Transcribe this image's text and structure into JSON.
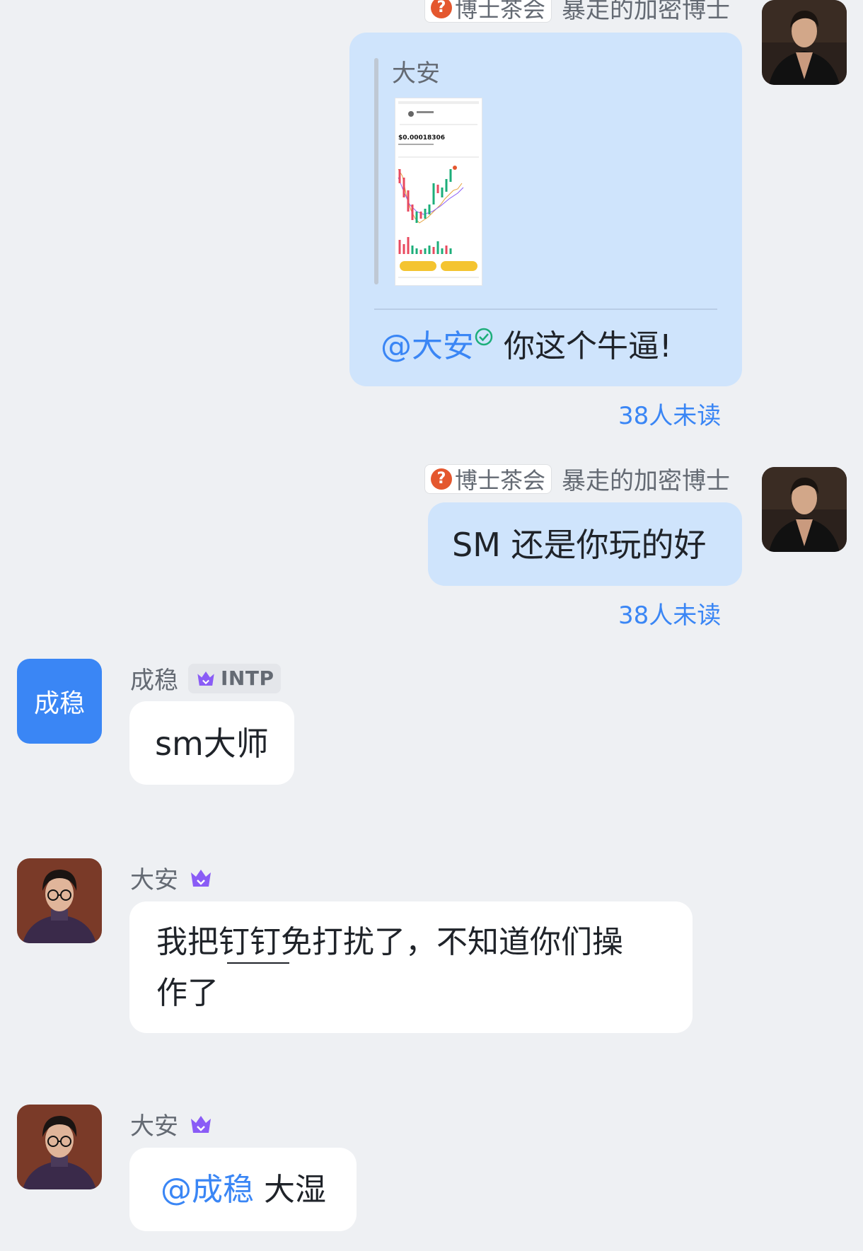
{
  "messages": {
    "m1": {
      "org_tag": "博士茶会",
      "sender": "暴走的加密博士",
      "quote_author": "大安",
      "quote_image": {
        "token": "SM",
        "price": "$0.00018306",
        "buttons": [
          "",
          ""
        ]
      },
      "mention": "@大安",
      "text": "你这个牛逼!",
      "unread": "38人未读"
    },
    "m2": {
      "org_tag": "博士茶会",
      "sender": "暴走的加密博士",
      "text": "SM 还是你玩的好",
      "unread": "38人未读"
    },
    "m3": {
      "avatar_text": "成稳",
      "sender": "成稳",
      "mbti": "INTP",
      "text": "sm大师"
    },
    "m4": {
      "sender": "大安",
      "text_line1": "我把钉钉免打扰了，不知道你们操",
      "text_line2": "作了"
    },
    "m5": {
      "sender": "大安",
      "mention": "@成稳",
      "text": "大湿"
    }
  },
  "colors": {
    "accent": "#3a86f5",
    "bubble_out": "#cfe4fc",
    "bubble_in": "#ffffff",
    "background": "#eef0f3",
    "crown": "#8a5cf6"
  }
}
